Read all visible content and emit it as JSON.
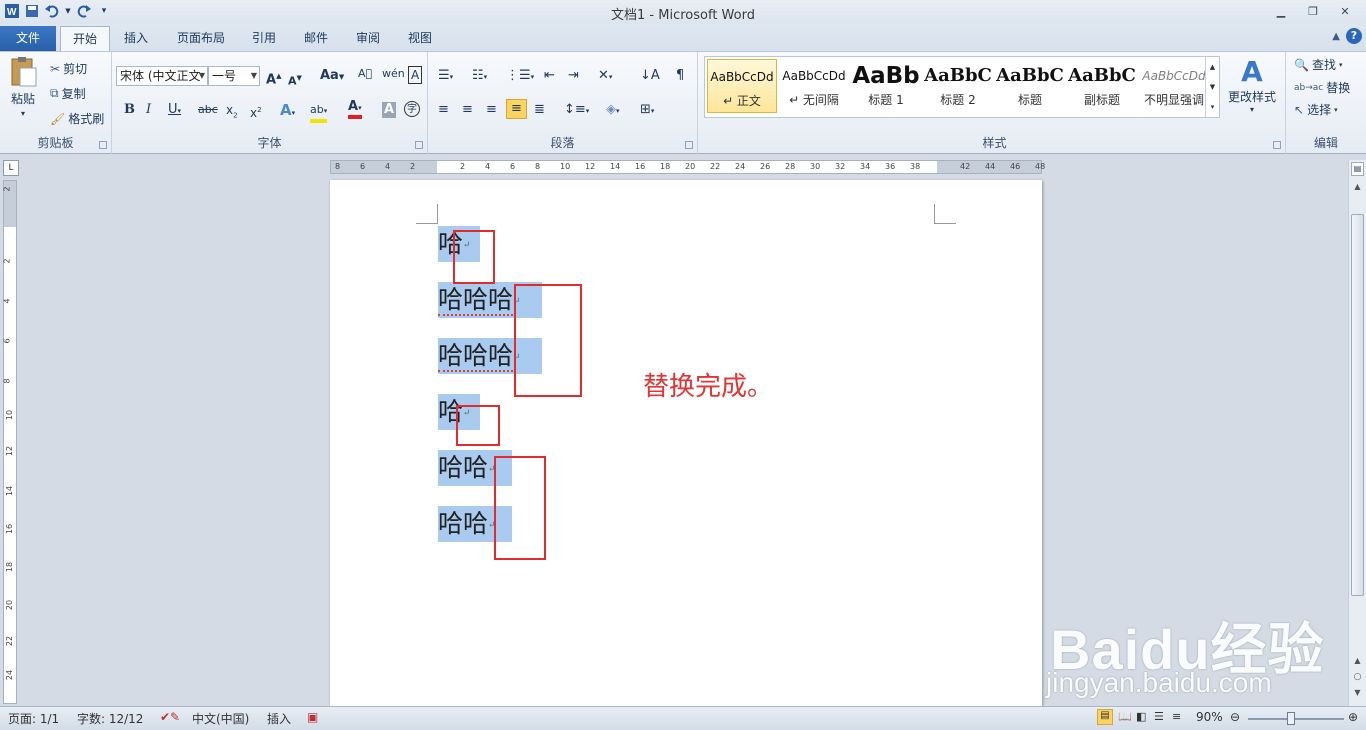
{
  "window": {
    "title": "文档1 - Microsoft Word"
  },
  "tabs": [
    {
      "label": "文件"
    },
    {
      "label": "开始"
    },
    {
      "label": "插入"
    },
    {
      "label": "页面布局"
    },
    {
      "label": "引用"
    },
    {
      "label": "邮件"
    },
    {
      "label": "审阅"
    },
    {
      "label": "视图"
    }
  ],
  "clipboard": {
    "paste": "粘贴",
    "cut": "剪切",
    "copy": "复制",
    "format_painter": "格式刷",
    "group": "剪贴板"
  },
  "font": {
    "name": "宋体 (中文正文",
    "size": "一号",
    "group": "字体",
    "case_label": "Aa"
  },
  "paragraph": {
    "group": "段落"
  },
  "styles": {
    "group": "样式",
    "items": [
      {
        "preview": "AaBbCcDd",
        "name": "↵ 正文"
      },
      {
        "preview": "AaBbCcDd",
        "name": "↵ 无间隔"
      },
      {
        "preview": "AaBb",
        "name": "标题 1"
      },
      {
        "preview": "AaBbC",
        "name": "标题 2"
      },
      {
        "preview": "AaBbC",
        "name": "标题"
      },
      {
        "preview": "AaBbC",
        "name": "副标题"
      },
      {
        "preview": "AaBbCcDd",
        "name": "不明显强调"
      }
    ],
    "change_styles": "更改样式"
  },
  "editing": {
    "find": "查找",
    "replace": "替换",
    "select": "选择",
    "group": "编辑"
  },
  "ruler": {
    "h_numbers": [
      "8",
      "6",
      "4",
      "2",
      "2",
      "4",
      "6",
      "8",
      "10",
      "12",
      "14",
      "16",
      "18",
      "20",
      "22",
      "24",
      "26",
      "28",
      "30",
      "32",
      "34",
      "36",
      "38",
      "42",
      "44",
      "46",
      "48"
    ],
    "v_numbers": [
      "2",
      "2",
      "4",
      "6",
      "8",
      "10",
      "12",
      "14",
      "16",
      "18",
      "20",
      "22",
      "24"
    ]
  },
  "document": {
    "lines": [
      {
        "text": "哈"
      },
      {
        "text": "哈哈哈"
      },
      {
        "text": "哈哈哈"
      },
      {
        "text": "哈"
      },
      {
        "text": "哈哈"
      },
      {
        "text": "哈哈"
      }
    ],
    "annotation": "替换完成。"
  },
  "status": {
    "page": "页面: 1/1",
    "words": "字数: 12/12",
    "language": "中文(中国)",
    "mode": "插入",
    "zoom": "90%"
  },
  "watermark": {
    "brand": "Baidu经验",
    "url": "jingyan.baidu.com"
  },
  "colors": {
    "accent": "#2b5797",
    "selection": "#a9cbf0",
    "annotation": "#e53333"
  }
}
